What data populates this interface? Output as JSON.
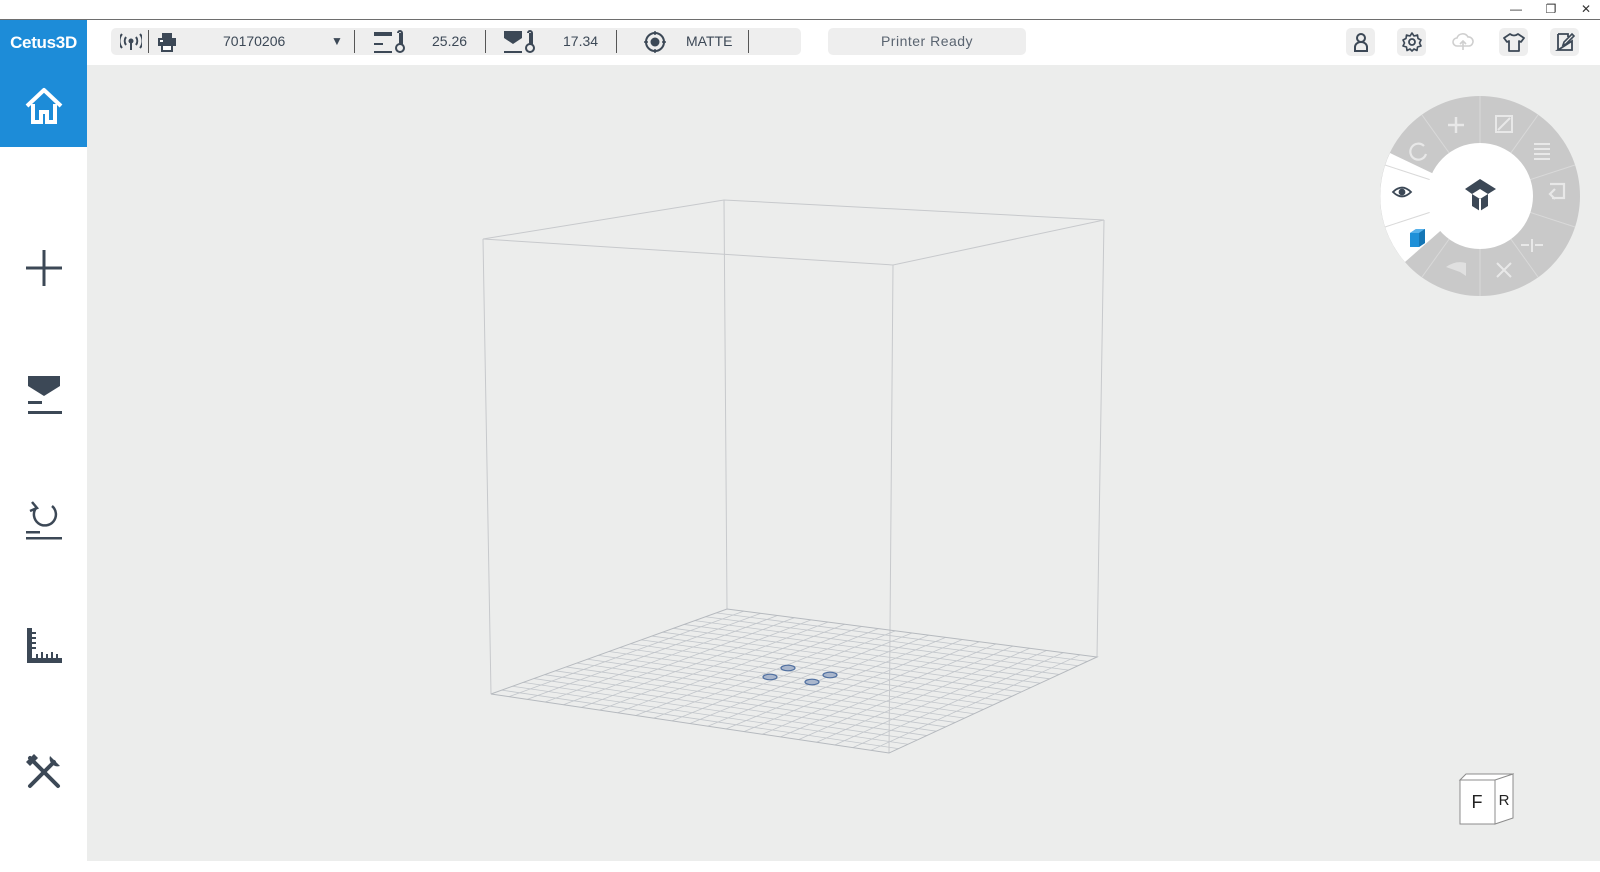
{
  "app": {
    "logo": "Cetus3D"
  },
  "window_controls": {
    "minimize": "—",
    "restore": "❐",
    "close": "✕"
  },
  "toolbar": {
    "printer_id": "70170206",
    "dropdown_arrow": "▼",
    "platform_temp": "25.26",
    "nozzle_temp": "17.34",
    "quality_mode": "MATTE",
    "printer_status": "Printer Ready"
  },
  "view_cube": {
    "front": "F",
    "right": "R"
  },
  "colors": {
    "accent": "#1d8cd8",
    "icon": "#3c4856",
    "viewport_bg": "#ecedec",
    "radial_ring": "#c9c9c9",
    "cube_blue": "#1e90d8"
  },
  "icons": {
    "sidebar": [
      "home-icon",
      "add-icon",
      "print-icon",
      "maintenance-icon",
      "calibrate-icon",
      "tools-icon"
    ],
    "toolbar": [
      "connection-icon",
      "printer-icon",
      "platform-temp-icon",
      "nozzle-temp-icon",
      "quality-icon"
    ],
    "right": [
      "user-icon",
      "settings-icon",
      "cloud-icon",
      "shirt-icon",
      "edit-icon"
    ],
    "radial": [
      "move-icon",
      "scale-icon",
      "rotate-icon",
      "layer-icon",
      "undo-icon",
      "view-icon",
      "mirror-icon",
      "cube-icon",
      "hand-icon",
      "explode-icon"
    ]
  }
}
